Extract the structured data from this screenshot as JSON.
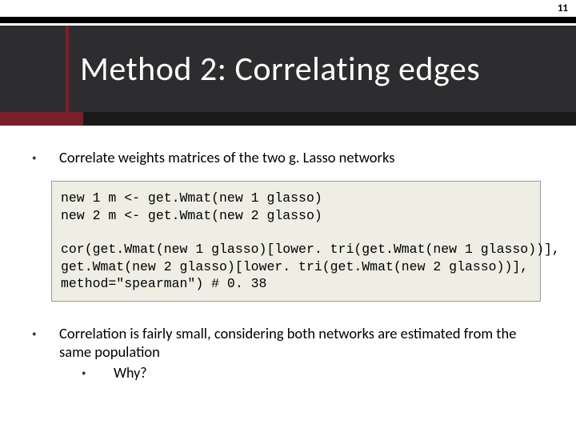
{
  "page_number": "11",
  "title": "Method 2: Correlating edges",
  "bullets": {
    "b1": "Correlate weights matrices of the two g. Lasso networks",
    "b2": "Correlation is fairly small, considering both networks are estimated from the same population",
    "b2_sub": "Why?"
  },
  "code": {
    "line1": "new 1 m <- get.Wmat(new 1 glasso)",
    "line2": "new 2 m <- get.Wmat(new 2 glasso)",
    "blank": "",
    "line3": "cor(get.Wmat(new 1 glasso)[lower. tri(get.Wmat(new 1 glasso))],",
    "line4": "get.Wmat(new 2 glasso)[lower. tri(get.Wmat(new 2 glasso))],",
    "line5": "method=\"spearman\") # 0. 38"
  }
}
